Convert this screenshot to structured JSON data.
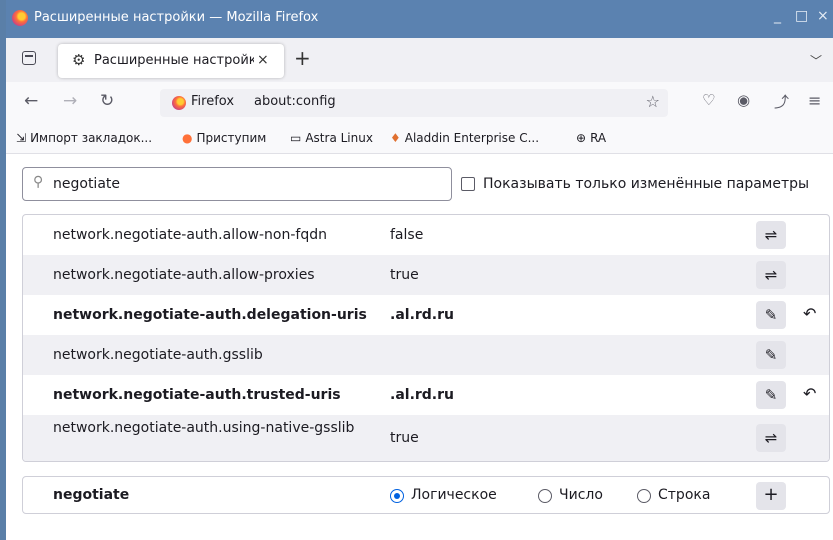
{
  "window": {
    "title": "Расширенные настройки — Mozilla Firefox",
    "minimize": "_",
    "maximize": "□",
    "close": "×"
  },
  "tab": {
    "label": "Расширенные настройки",
    "close": "×",
    "icon": "gear-icon"
  },
  "new_tab": "+",
  "nav": {
    "back": "←",
    "forward": "→",
    "reload": "↻",
    "identity_label": "Firefox",
    "url": "about:config",
    "star": "☆",
    "pocket": "♡",
    "account": "◉",
    "share": "⤴",
    "menu": "≡"
  },
  "bookmarks": [
    {
      "icon": "⇲",
      "label": "Импорт закладок..."
    },
    {
      "icon": "●",
      "label": "Приступим"
    },
    {
      "icon": "▭",
      "label": "Astra Linux"
    },
    {
      "icon": "♦",
      "label": "Aladdin Enterprise C..."
    },
    {
      "icon": "⊕",
      "label": "RA"
    }
  ],
  "search": {
    "value": "negotiate",
    "icon": "search-icon"
  },
  "show_modified_label": "Показывать только изменённые параметры",
  "prefs": [
    {
      "name": "network.negotiate-auth.allow-non-fqdn",
      "value": "false",
      "action": "⇌",
      "modified": false,
      "reset": ""
    },
    {
      "name": "network.negotiate-auth.allow-proxies",
      "value": "true",
      "action": "⇌",
      "modified": false,
      "reset": ""
    },
    {
      "name": "network.negotiate-auth.delegation-uris",
      "value": ".al.rd.ru",
      "action": "✎",
      "modified": true,
      "reset": "↶"
    },
    {
      "name": "network.negotiate-auth.gsslib",
      "value": "",
      "action": "✎",
      "modified": false,
      "reset": ""
    },
    {
      "name": "network.negotiate-auth.trusted-uris",
      "value": ".al.rd.ru",
      "action": "✎",
      "modified": true,
      "reset": "↶"
    },
    {
      "name": "network.negotiate-auth.using-native-gsslib",
      "value": "true",
      "action": "⇌",
      "modified": false,
      "reset": ""
    }
  ],
  "add": {
    "name": "negotiate",
    "options": [
      "Логическое",
      "Число",
      "Строка"
    ],
    "selected": 0,
    "button": "+"
  }
}
